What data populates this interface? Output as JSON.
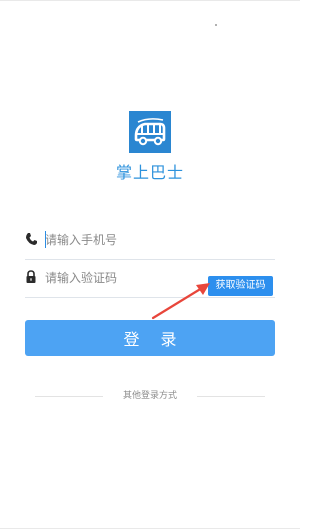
{
  "app": {
    "name": "掌上巴士",
    "logo_icon": "bus-icon",
    "brand_color": "#2a86d1"
  },
  "form": {
    "phone": {
      "icon": "phone-icon",
      "placeholder": "请输入手机号",
      "value": ""
    },
    "code": {
      "icon": "lock-icon",
      "placeholder": "请输入验证码",
      "value": "",
      "get_code_label": "获取验证码"
    }
  },
  "login_label": "登 录",
  "other_login_label": "其他登录方式",
  "colors": {
    "accent": "#4da3f3",
    "code_button": "#2c8fee",
    "annotation_arrow": "#e8463b"
  }
}
